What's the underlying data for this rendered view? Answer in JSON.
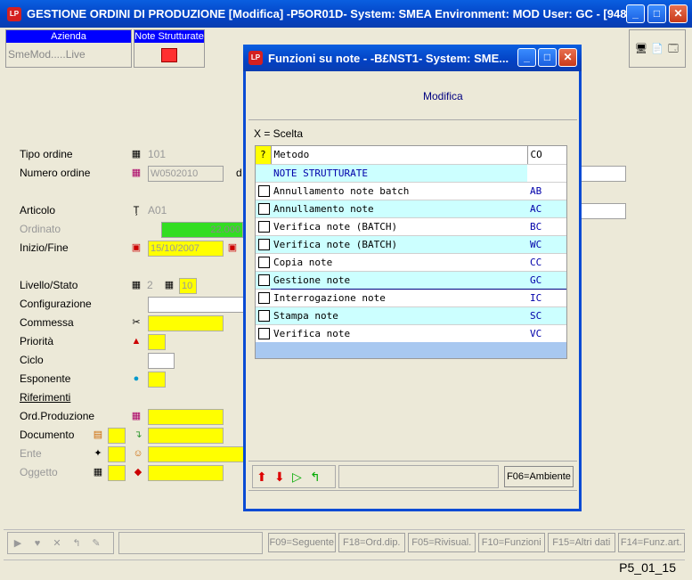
{
  "window": {
    "title": "GESTIONE ORDINI DI PRODUZIONE [Modifica] -P5OR01D- System: SMEA Environment: MOD User: GC - [948..."
  },
  "top": {
    "azienda_header": "Azienda",
    "azienda_value": "SmeMod.....Live",
    "note_header": "Note Strutturate"
  },
  "form": {
    "tipo_ordine_label": "Tipo ordine",
    "tipo_ordine_value": "101",
    "numero_ordine_label": "Numero ordine",
    "numero_ordine_value": "W0502010",
    "numero_suffix": "d",
    "articolo_label": "Articolo",
    "articolo_value": "A01",
    "ordinato_label": "Ordinato",
    "ordinato_value": "22.000",
    "inizio_fine_label": "Inizio/Fine",
    "inizio_value": "15/10/2007",
    "livello_stato_label": "Livello/Stato",
    "livello_value": "2",
    "stato_value": "10",
    "configurazione_label": "Configurazione",
    "commessa_label": "Commessa",
    "priorita_label": "Priorità",
    "ciclo_label": "Ciclo",
    "esponente_label": "Esponente",
    "riferimenti_label": "Riferimenti",
    "ord_produzione_label": "Ord.Produzione",
    "documento_label": "Documento",
    "ente_label": "Ente",
    "oggetto_label": "Oggetto"
  },
  "dialog": {
    "title": "Funzioni su note - -B£NST1- System: SME...",
    "mode": "Modifica",
    "legend": "X = Scelta",
    "columns": {
      "q": "?",
      "metodo": "Metodo",
      "co": "CO"
    },
    "group": "NOTE STRUTTURATE",
    "rows": [
      {
        "metodo": "Annullamento note batch",
        "co": "AB"
      },
      {
        "metodo": "Annullamento note",
        "co": "AC"
      },
      {
        "metodo": "Verifica note (BATCH)",
        "co": "BC"
      },
      {
        "metodo": "Verifica note (BATCH)",
        "co": "WC"
      },
      {
        "metodo": "Copia note",
        "co": "CC"
      },
      {
        "metodo": "Gestione note",
        "co": "GC"
      },
      {
        "metodo": "Interrogazione note",
        "co": "IC"
      },
      {
        "metodo": "Stampa note",
        "co": "SC"
      },
      {
        "metodo": "Verifica note",
        "co": "VC"
      }
    ],
    "f06": "F06=Ambiente"
  },
  "bottom": {
    "buttons": [
      "F09=Seguente",
      "F18=Ord.dip.",
      "F05=Rivisual.",
      "F10=Funzioni",
      "F15=Altri dati",
      "F14=Funz.art."
    ],
    "status": "P5_01_15"
  }
}
